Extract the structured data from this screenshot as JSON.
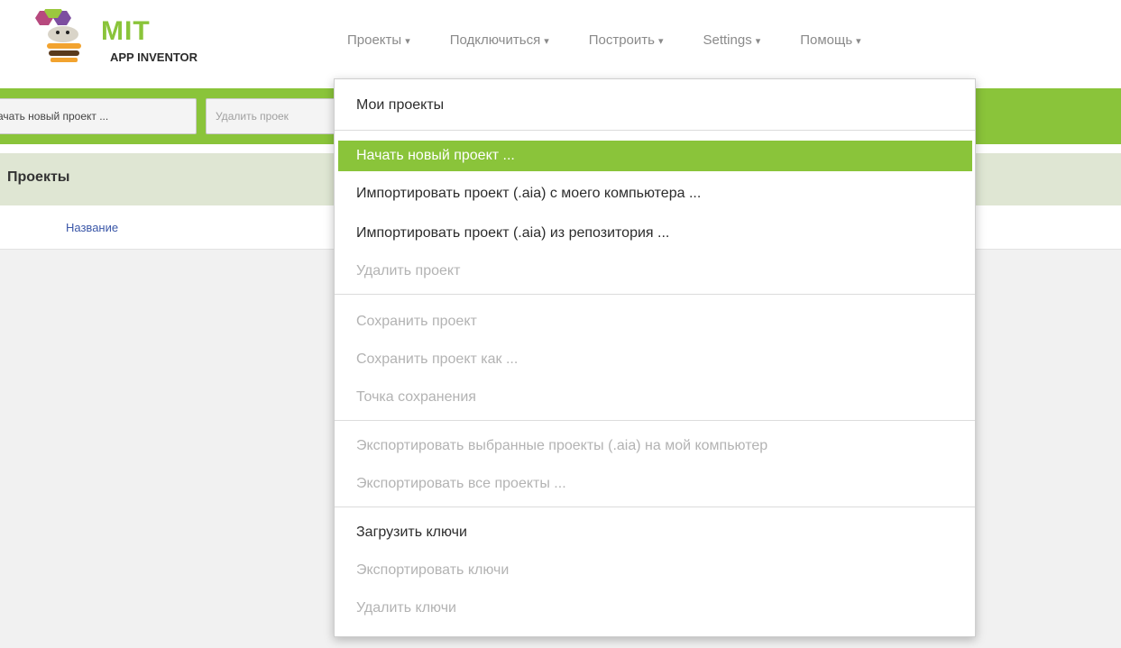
{
  "logo": {
    "title": "MIT",
    "subtitle": "APP INVENTOR"
  },
  "nav": [
    {
      "label": "Проекты",
      "caret": "▾"
    },
    {
      "label": "Подключиться",
      "caret": "▾"
    },
    {
      "label": "Построить",
      "caret": "▾"
    },
    {
      "label": "Settings",
      "caret": "▾"
    },
    {
      "label": "Помощь",
      "caret": "▾"
    }
  ],
  "toolbar": {
    "new_project": "ачать новый проект ...",
    "delete_project": "Удалить проек"
  },
  "projects_panel": {
    "title": "Проекты",
    "column_name": "Название"
  },
  "menu": {
    "items": [
      {
        "label": "Мои проекты",
        "state": "enabled"
      },
      {
        "label": "Начать новый проект ...",
        "state": "highlighted"
      },
      {
        "label": "Импортировать проект (.aia) с моего компьютера ...",
        "state": "enabled"
      },
      {
        "label": "Импортировать проект (.aia) из репозитория ...",
        "state": "enabled"
      },
      {
        "label": "Удалить проект",
        "state": "disabled"
      },
      {
        "label": "Сохранить проект",
        "state": "disabled"
      },
      {
        "label": "Сохранить проект как ...",
        "state": "disabled"
      },
      {
        "label": "Точка сохранения",
        "state": "disabled"
      },
      {
        "label": "Экспортировать выбранные проекты (.aia) на мой компьютер",
        "state": "disabled"
      },
      {
        "label": "Экспортировать все проекты ...",
        "state": "disabled"
      },
      {
        "label": "Загрузить ключи",
        "state": "enabled"
      },
      {
        "label": "Экспортировать ключи",
        "state": "disabled"
      },
      {
        "label": "Удалить ключи",
        "state": "disabled"
      }
    ]
  },
  "colors": {
    "accent": "#8ac43a",
    "panel_header": "#dfe6d3",
    "link": "#3b57a8"
  }
}
